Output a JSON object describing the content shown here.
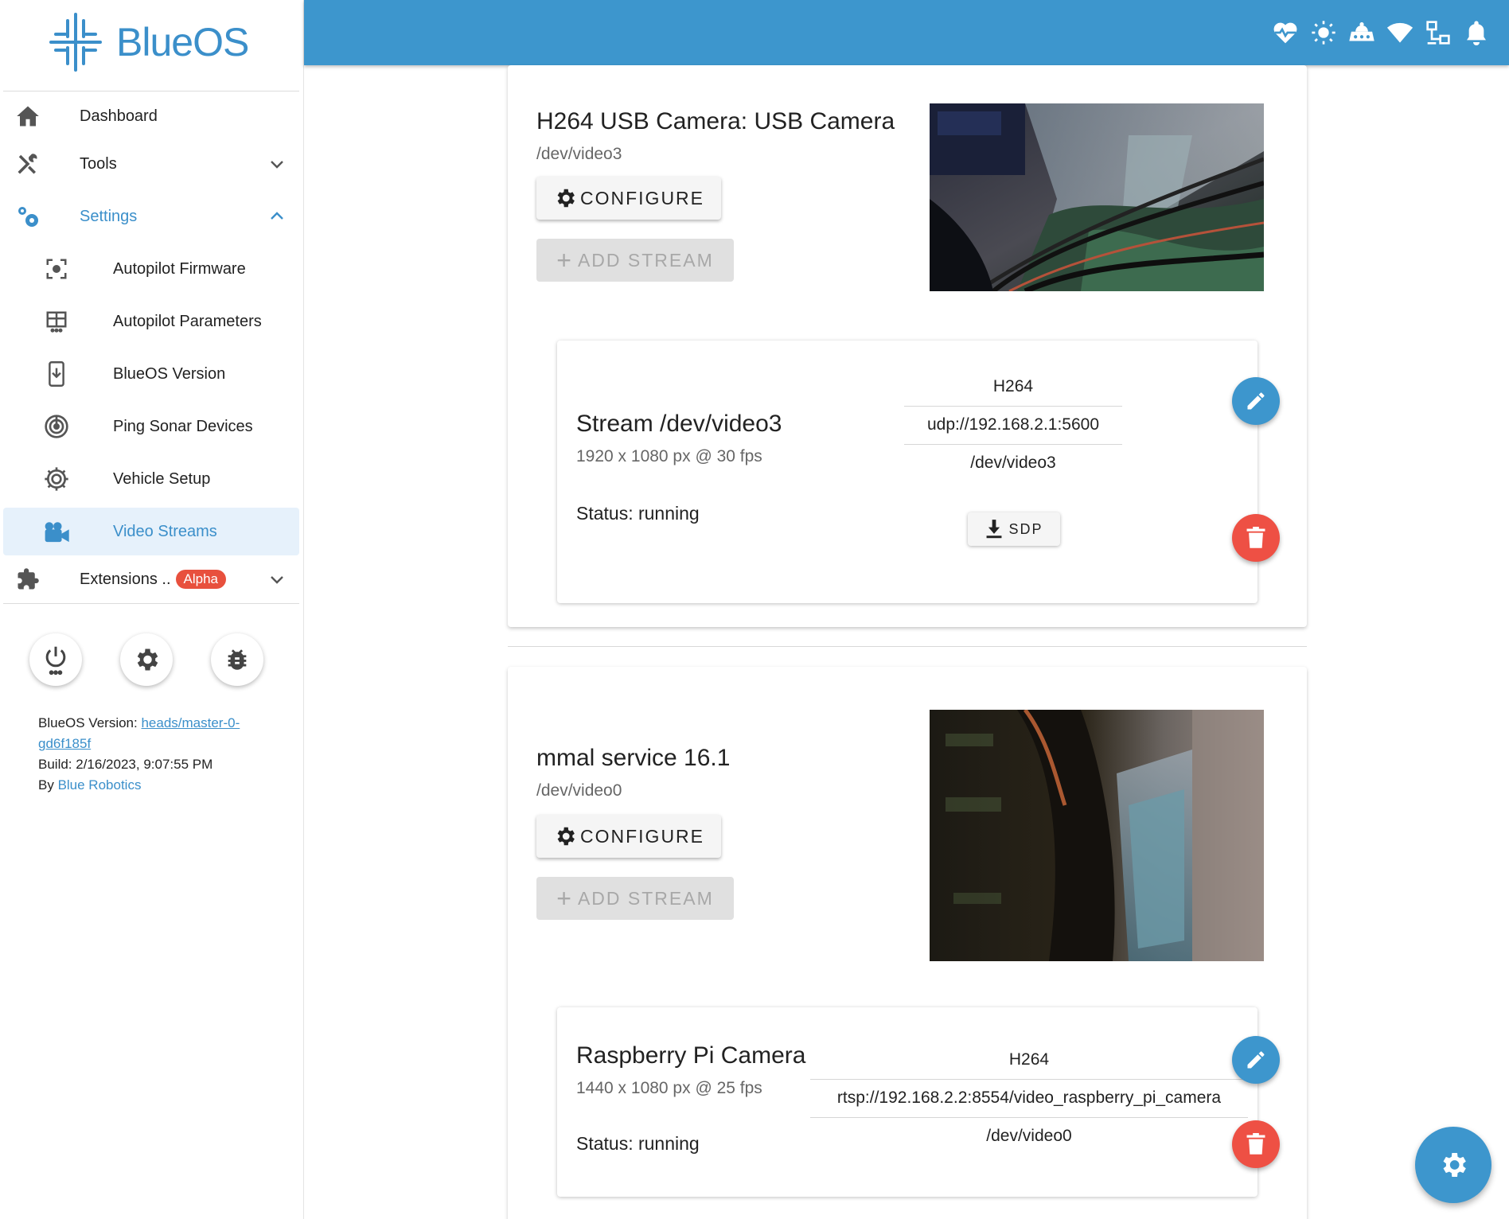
{
  "app": {
    "name": "BlueOS"
  },
  "colors": {
    "primary": "#3d96cd",
    "danger": "#ee5044",
    "alpha_badge": "#e8503d"
  },
  "sidebar": {
    "items": [
      {
        "label": "Dashboard",
        "icon": "home-icon"
      },
      {
        "label": "Tools",
        "icon": "tools-icon"
      },
      {
        "label": "Settings",
        "icon": "settings-cogs-icon"
      },
      {
        "label": "Autopilot Firmware",
        "icon": "firmware-icon"
      },
      {
        "label": "Autopilot Parameters",
        "icon": "parameters-table-icon"
      },
      {
        "label": "BlueOS Version",
        "icon": "version-download-icon"
      },
      {
        "label": "Ping Sonar Devices",
        "icon": "sonar-icon"
      },
      {
        "label": "Vehicle Setup",
        "icon": "vehicle-setup-gear-icon"
      },
      {
        "label": "Video Streams",
        "icon": "video-camera-icon"
      },
      {
        "label": "Extensions ..",
        "icon": "puzzle-icon",
        "badge": "Alpha"
      }
    ],
    "footer": {
      "version_label": "BlueOS Version: ",
      "version_link": "heads/master-0-gd6f185f",
      "build": "Build: 2/16/2023, 9:07:55 PM",
      "by_label": "By ",
      "by_link": "Blue Robotics"
    }
  },
  "topbar": {
    "icons": [
      "heartbeat-icon",
      "brightness-icon",
      "vehicle-icon",
      "wifi-icon",
      "network-icon",
      "bell-icon"
    ]
  },
  "cameras": [
    {
      "title": "H264 USB Camera: USB Camera",
      "device": "/dev/video3",
      "configure_label": "CONFIGURE",
      "add_stream_label": "ADD STREAM",
      "stream": {
        "title": "Stream /dev/video3",
        "resolution": "1920 x 1080 px @ 30 fps",
        "status": "Status: running",
        "encode": "H264",
        "endpoint": "udp://192.168.2.1:5600",
        "source": "/dev/video3",
        "sdp_label": "SDP"
      }
    },
    {
      "title": "mmal service 16.1",
      "device": "/dev/video0",
      "configure_label": "CONFIGURE",
      "add_stream_label": "ADD STREAM",
      "stream": {
        "title": "Raspberry Pi Camera",
        "resolution": "1440 x 1080 px @ 25 fps",
        "status": "Status: running",
        "encode": "H264",
        "endpoint": "rtsp://192.168.2.2:8554/video_raspberry_pi_camera",
        "source": "/dev/video0"
      }
    }
  ]
}
